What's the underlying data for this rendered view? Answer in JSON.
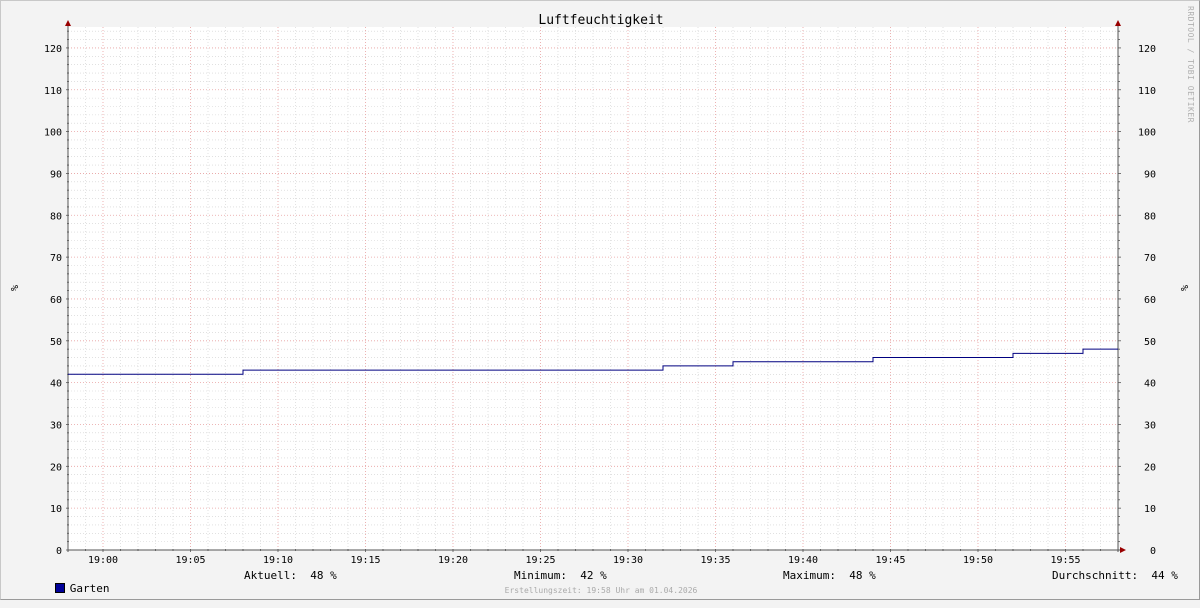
{
  "chart_data": {
    "type": "line",
    "title": "Luftfeuchtigkeit",
    "ylabel": "%",
    "ylabel_right": "%",
    "ylim": [
      0,
      125
    ],
    "yticks": [
      0,
      10,
      20,
      30,
      40,
      50,
      60,
      70,
      80,
      90,
      100,
      110,
      120
    ],
    "xlim": [
      "18:58",
      "19:58"
    ],
    "xticks": [
      "19:00",
      "19:05",
      "19:10",
      "19:15",
      "19:20",
      "19:25",
      "19:30",
      "19:35",
      "19:40",
      "19:45",
      "19:50",
      "19:55"
    ],
    "grid": true,
    "step": true,
    "series": [
      {
        "name": "Garten",
        "color": "#000080",
        "x": [
          "18:58",
          "19:08",
          "19:32",
          "19:36",
          "19:44",
          "19:52",
          "19:56",
          "19:58"
        ],
        "y": [
          42,
          43,
          44,
          45,
          46,
          47,
          48,
          48
        ]
      }
    ]
  },
  "legend": {
    "series_label": "Garten",
    "swatch_color": "#000099",
    "aktuell": "Aktuell:  48 %",
    "minimum": "Minimum:  42 %",
    "maximum": "Maximum:  48 %",
    "durchschnitt": "Durchschnitt:  44 %"
  },
  "watermark": "RRDTOOL / TOBI OETIKER",
  "footer": "Erstellungszeit: 19:58 Uhr am 01.04.2026",
  "colors": {
    "background": "#f3f3f3",
    "canvas": "#ffffff",
    "major_grid": "#e8a0a0",
    "minor_grid": "#cfcfcf",
    "axis": "#555555",
    "arrow": "#990000"
  }
}
